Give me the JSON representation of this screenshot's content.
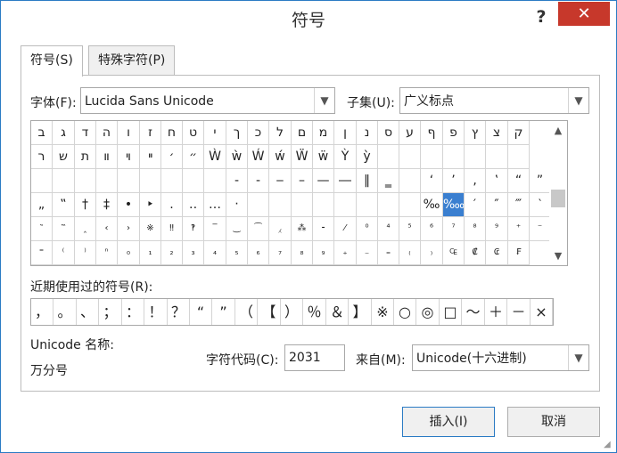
{
  "window": {
    "title": "符号",
    "help": "?",
    "close": "✕"
  },
  "tabs": [
    {
      "label": "符号(S)",
      "active": true
    },
    {
      "label": "特殊字符(P)",
      "active": false
    }
  ],
  "font": {
    "label": "字体(F):",
    "value": "Lucida Sans Unicode"
  },
  "subset": {
    "label": "子集(U):",
    "value": "广义标点"
  },
  "symbol_grid": {
    "rows": [
      [
        "ב",
        "ג",
        "ד",
        "ה",
        "ו",
        "ז",
        "ח",
        "ט",
        "י",
        "ך",
        "כ",
        "ל",
        "ם",
        "מ",
        "ן",
        "נ",
        "ס",
        "ע",
        "ף",
        "פ",
        "ץ",
        "צ",
        "ק"
      ],
      [
        "ר",
        "ש",
        "ת",
        "װ",
        "ױ",
        "ײ",
        "׳",
        "״",
        "Ẁ",
        "ẁ",
        "Ẃ",
        "ẃ",
        "Ẅ",
        "ẅ",
        "Ỳ",
        "ỳ",
        "",
        "",
        "",
        "",
        "",
        "",
        ""
      ],
      [
        "",
        "",
        "",
        "",
        "",
        "",
        "",
        "",
        "",
        "‐",
        "‑",
        "‒",
        "–",
        "—",
        "―",
        "‖",
        "‗",
        "",
        "‘",
        "’",
        "‚",
        "‛",
        "“",
        "”"
      ],
      [
        "„",
        "‟",
        "†",
        "‡",
        "•",
        "‣",
        "․",
        "‥",
        "…",
        "‧",
        "",
        "",
        "",
        "",
        "",
        "",
        "",
        "",
        "‰",
        "‱",
        "′",
        "″",
        "‴",
        "‵"
      ],
      [
        "‶",
        "‷",
        "‸",
        "‹",
        "›",
        "※",
        "‼",
        "‽",
        "‾",
        "‿",
        "⁀",
        "⁁",
        "⁂",
        "⁃",
        "⁄",
        "⁰",
        "⁴",
        "⁵",
        "⁶",
        "⁷",
        "⁸",
        "⁹",
        "⁺",
        "⁻"
      ],
      [
        "⁼",
        "⁽",
        "⁾",
        "ⁿ",
        "₀",
        "₁",
        "₂",
        "₃",
        "₄",
        "₅",
        "₆",
        "₇",
        "₈",
        "₉",
        "₊",
        "₋",
        "₌",
        "₍",
        "₎",
        "₠",
        "₡",
        "₢",
        "₣"
      ]
    ],
    "selected_symbol": "‱"
  },
  "recent": {
    "label": "近期使用过的符号(R):",
    "symbols": [
      "，",
      "。",
      "、",
      "；",
      "：",
      "！",
      "？",
      "“",
      "”",
      "（",
      "【",
      "）",
      "％",
      "＆",
      "】",
      "※",
      "○",
      "◎",
      "□",
      "～",
      "＋",
      "－",
      "×"
    ]
  },
  "unicode_name": {
    "label": "Unicode 名称:",
    "value": "万分号"
  },
  "char_code": {
    "label": "字符代码(C):",
    "value": "2031"
  },
  "from": {
    "label": "来自(M):",
    "value": "Unicode(十六进制)"
  },
  "buttons": {
    "insert": "插入(I)",
    "cancel": "取消"
  }
}
